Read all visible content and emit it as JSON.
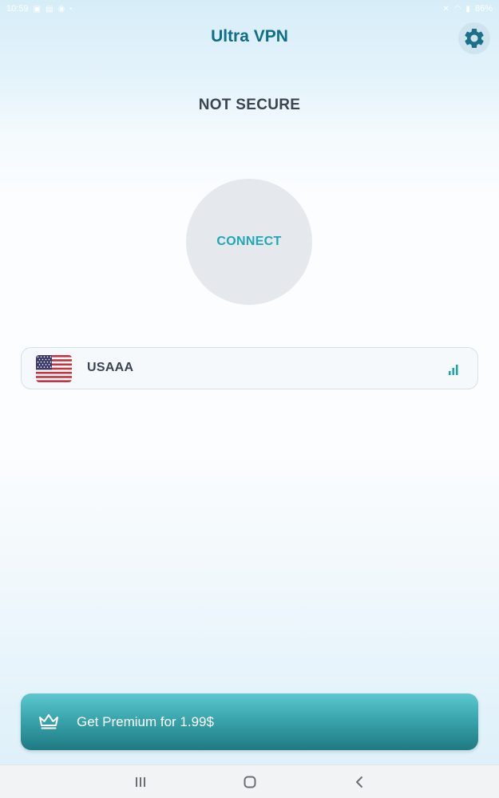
{
  "status_bar": {
    "time": "10:59",
    "battery": "86%"
  },
  "header": {
    "title": "Ultra VPN",
    "settings_icon": "gear-icon"
  },
  "connection": {
    "status": "NOT SECURE",
    "connect_label": "CONNECT"
  },
  "server": {
    "name": "USAAA",
    "flag_icon": "us-flag-icon",
    "signal_icon": "signal-bars-icon"
  },
  "premium": {
    "label": "Get Premium for 1.99$",
    "icon": "crown-icon"
  },
  "colors": {
    "accent": "#0f6f86",
    "connect_text": "#20a7b5",
    "premium_gradient_top": "#5ec7cf",
    "premium_gradient_bottom": "#1f7a82"
  },
  "nav": {
    "recents_icon": "recents-icon",
    "home_icon": "home-icon",
    "back_icon": "back-icon"
  }
}
